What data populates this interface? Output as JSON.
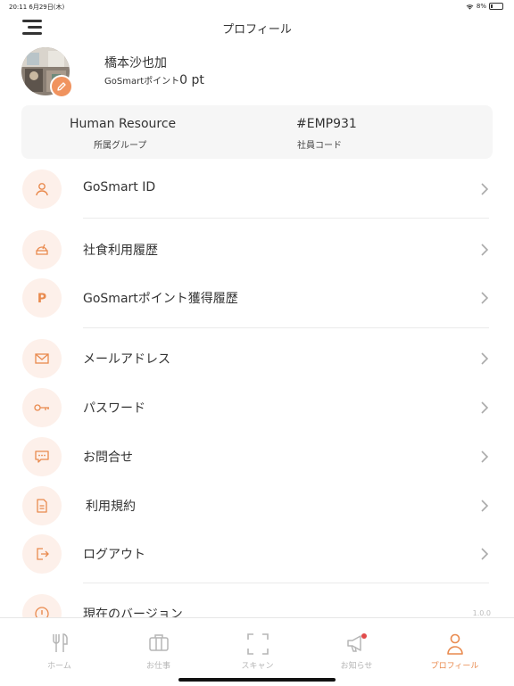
{
  "status_bar": {
    "time": "20:11 6月29日(木)",
    "battery": "8%"
  },
  "nav": {
    "title": "プロフィール"
  },
  "profile": {
    "name": "橋本沙也加",
    "points_label": "GoSmartポイント",
    "points_value": "0 pt"
  },
  "info": {
    "group_value": "Human Resource",
    "group_label": "所属グループ",
    "code_value": "#EMP931",
    "code_label": "社員コード"
  },
  "menu": [
    {
      "label": "GoSmart ID",
      "icon": "person-icon"
    },
    {
      "label": "社食利用履歴",
      "icon": "meal-icon"
    },
    {
      "label": "GoSmartポイント獲得履歴",
      "icon": "points-p-icon"
    },
    {
      "label": "メールアドレス",
      "icon": "mail-icon"
    },
    {
      "label": "パスワード",
      "icon": "key-icon"
    },
    {
      "label": "お問合せ",
      "icon": "chat-icon"
    },
    {
      "label": "利用規約",
      "icon": "document-icon"
    },
    {
      "label": "ログアウト",
      "icon": "logout-icon"
    },
    {
      "label": "現在のバージョン",
      "icon": "info-icon"
    }
  ],
  "version": "1.0.0",
  "tabs": [
    {
      "label": "ホーム",
      "icon": "fork-knife-icon",
      "active": false
    },
    {
      "label": "お仕事",
      "icon": "briefcase-icon",
      "active": false
    },
    {
      "label": "スキャン",
      "icon": "scan-icon",
      "active": false
    },
    {
      "label": "お知らせ",
      "icon": "megaphone-icon",
      "active": false
    },
    {
      "label": "プロフィール",
      "icon": "person-icon",
      "active": true
    }
  ],
  "colors": {
    "accent": "#e98a4e",
    "icon_bg": "#fdf0ea",
    "card_bg": "#f6f6f6",
    "inactive": "#b5b5b5"
  }
}
